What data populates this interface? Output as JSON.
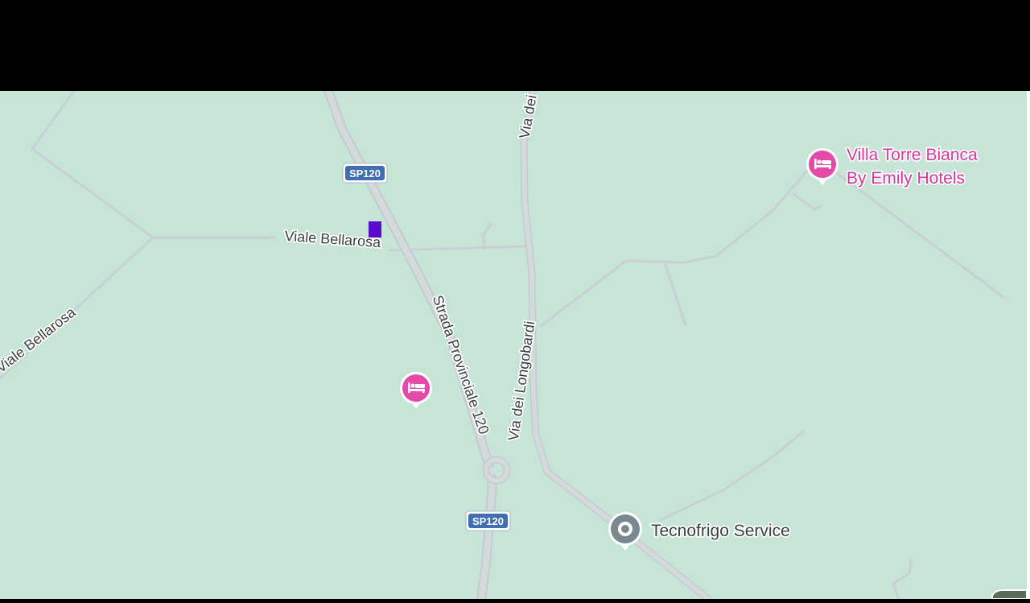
{
  "roads": {
    "sp120_shield_top": "SP120",
    "sp120_shield_bottom": "SP120",
    "viale_bellarosa": "Viale Bellarosa",
    "viale_bellarosa_left": "Viale Bellarosa",
    "strada_provinciale": "Strada Provinciale 120",
    "via_dei_longobardi": "Via dei Longobardi",
    "via_dei_top": "Via dei"
  },
  "places": {
    "hotel_name_line1": "Villa Torre Bianca",
    "hotel_name_line2": "By Emily Hotels",
    "service_name": "Tecnofrigo Service"
  },
  "icons": {
    "hotel_pin": "bed-icon",
    "service_pin": "location-pin-icon"
  },
  "colors": {
    "land": "#c6e5d6",
    "road_fill": "#d4d9dc",
    "road_casing": "#c3cbcf",
    "minor_road": "#c9d0d5",
    "hotel_pin": "#e54aa6",
    "hotel_label": "#d6379d",
    "service_pin": "#7a8890",
    "label_text": "#3c4043",
    "shield_blue": "#3f6fb0",
    "marker": "#5a0acb"
  }
}
